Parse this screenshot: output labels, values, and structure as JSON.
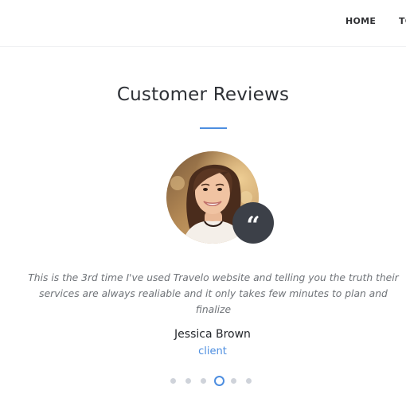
{
  "nav": {
    "items": [
      {
        "label": "HOME"
      },
      {
        "label": "TO"
      }
    ]
  },
  "section": {
    "title": "Customer Reviews",
    "accent_color": "#4d8ee0"
  },
  "review": {
    "badge_icon": "quote-icon",
    "badge_glyph": "“",
    "text": "This is the 3rd time I've used Travelo website and telling you the truth their services are always realiable and it only takes few minutes to plan and finalize",
    "name": "Jessica Brown",
    "role": "client"
  },
  "carousel": {
    "dot_count": 6,
    "active_index": 3,
    "active_color": "#4d8ee0",
    "inactive_color": "#cfd3da"
  }
}
